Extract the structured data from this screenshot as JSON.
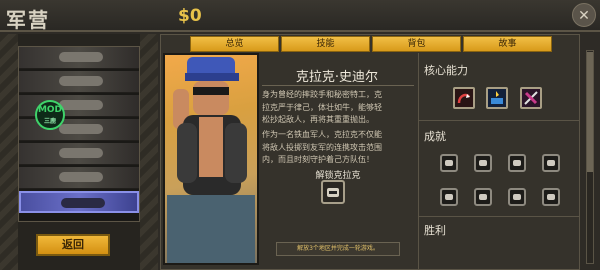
{
  "header": {
    "title": "军营",
    "money": "$0"
  },
  "badge": {
    "text": "MOD",
    "sub": "三鹿"
  },
  "roster": {
    "rows": [
      "",
      "",
      "",
      "",
      "",
      "selected",
      ""
    ]
  },
  "back_label": "返回",
  "tabs": [
    "总览",
    "技能",
    "背包",
    "故事"
  ],
  "character": {
    "name": "克拉克·史迪尔",
    "bio1": [
      "身为曾经的摔跤手和秘密特工，克",
      "拉克严于律己，体壮如牛，能够轻",
      "松抄起敌人，再将其重重抛出。"
    ],
    "bio2": [
      "作为一名铁血军人，克拉克不仅能",
      "将敌人投掷到友军的连携攻击范围",
      "内，而且时刻守护着己方队伍！"
    ],
    "unlock_label": "解锁克拉克",
    "unlock_req": "解放3个地区并完成一轮游戏。"
  },
  "sections": {
    "abilities": "核心能力",
    "achievements": "成就",
    "wins": "胜利"
  },
  "abilities": [
    {
      "icon": "grab-throw-icon",
      "color": "#d43030"
    },
    {
      "icon": "team-combo-icon",
      "color": "#3a8ad8"
    },
    {
      "icon": "guard-icon",
      "color": "#c83a8a"
    }
  ],
  "achievements": [
    "helmet-icon",
    "helmet-icon",
    "helmet-icon",
    "helmet-icon",
    "helmet-icon",
    "helmet-icon",
    "helmet-icon",
    "helmet-icon"
  ]
}
